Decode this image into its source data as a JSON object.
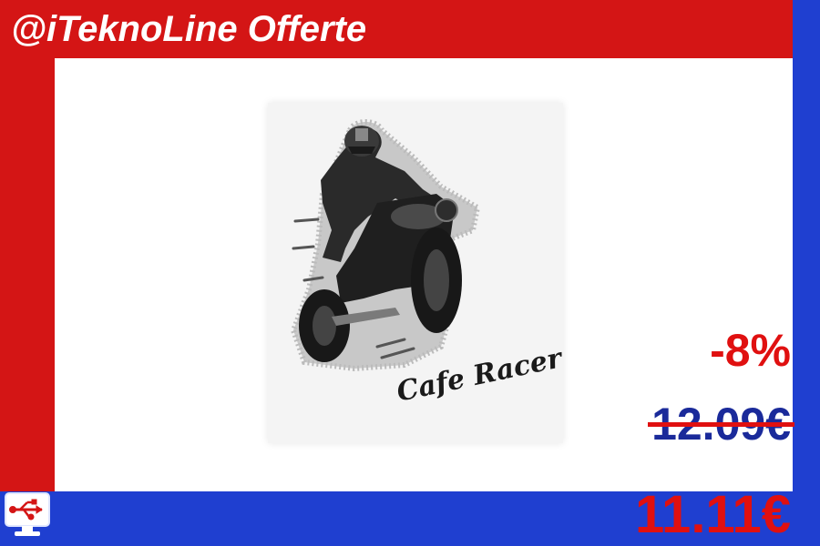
{
  "header": {
    "title": "@iTeknoLine Offerte"
  },
  "product": {
    "image": "cafe-racer-motorcycle-sticker",
    "sticker_text": "Cafe Racer"
  },
  "price": {
    "discount": "-8%",
    "old": "12.09€",
    "new": "11.11€"
  },
  "logo": {
    "icon": "usb-monitor-icon"
  },
  "colors": {
    "red": "#d41515",
    "blue": "#1f3fd0",
    "white": "#ffffff"
  }
}
